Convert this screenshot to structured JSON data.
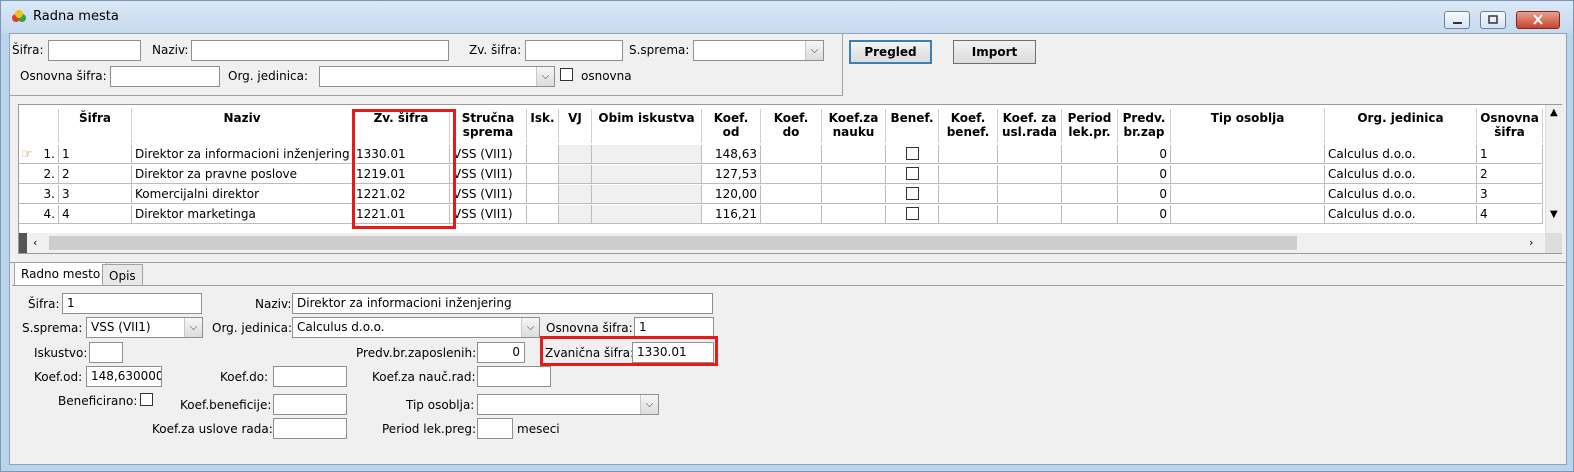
{
  "window": {
    "title": "Radna mesta"
  },
  "filter": {
    "sifra_label": "Šifra:",
    "sifra_value": "",
    "naziv_label": "Naziv:",
    "naziv_value": "",
    "zv_sifra_label": "Zv. šifra:",
    "zv_sifra_value": "",
    "ssprema_label": "S.sprema:",
    "ssprema_value": "",
    "osnovna_sifra_label": "Osnovna šifra:",
    "osnovna_sifra_value": "",
    "org_jedinica_label": "Org. jedinica:",
    "org_jedinica_value": "",
    "osnovna_label": "osnovna"
  },
  "buttons": {
    "pregled": "Pregled",
    "import": "Import"
  },
  "grid": {
    "headers": {
      "sifra": "Šifra",
      "naziv": "Naziv",
      "zv_sifra": "Zv. šifra",
      "strucna1": "Stručna",
      "strucna2": "sprema",
      "isk": "Isk.",
      "vj": "VJ",
      "obim": "Obim iskustva",
      "koef_od1": "Koef.",
      "koef_od2": "od",
      "koef_do1": "Koef.",
      "koef_do2": "do",
      "koef_za1": "Koef.za",
      "koef_za2": "nauku",
      "benef": "Benef.",
      "kbenef1": "Koef.",
      "kbenef2": "benef.",
      "kusl1": "Koef. za",
      "kusl2": "usl.rada",
      "per1": "Period",
      "per2": "lek.pr.",
      "predv1": "Predv.",
      "predv2": "br.zap",
      "tip": "Tip osoblja",
      "org": "Org. jedinica",
      "osn1": "Osnovna",
      "osn2": "šifra"
    },
    "rows": [
      {
        "n": "1.",
        "sifra": "1",
        "naziv": "Direktor za informacioni inženjering",
        "zv": "1330.01",
        "sprema": "VSS (VII1)",
        "koef_od": "148,63",
        "predv": "0",
        "org": "Calculus d.o.o.",
        "osn": "1"
      },
      {
        "n": "2.",
        "sifra": "2",
        "naziv": "Direktor za pravne poslove",
        "zv": "1219.01",
        "sprema": "VSS (VII1)",
        "koef_od": "127,53",
        "predv": "0",
        "org": "Calculus d.o.o.",
        "osn": "2"
      },
      {
        "n": "3.",
        "sifra": "3",
        "naziv": "Komercijalni direktor",
        "zv": "1221.02",
        "sprema": "VSS (VII1)",
        "koef_od": "120,00",
        "predv": "0",
        "org": "Calculus d.o.o.",
        "osn": "3"
      },
      {
        "n": "4.",
        "sifra": "4",
        "naziv": "Direktor marketinga",
        "zv": "1221.01",
        "sprema": "VSS (VII1)",
        "koef_od": "116,21",
        "predv": "0",
        "org": "Calculus d.o.o.",
        "osn": "4"
      }
    ]
  },
  "tabs": {
    "radno_mesto": "Radno mesto",
    "opis": "Opis"
  },
  "detail": {
    "sifra_label": "Šifra:",
    "sifra_value": "1",
    "naziv_label": "Naziv:",
    "naziv_value": "Direktor za informacioni inženjering",
    "ssprema_label": "S.sprema:",
    "ssprema_value": "VSS (VII1)",
    "org_label": "Org. jedinica:",
    "org_value": "Calculus d.o.o.",
    "osnovna_sifra_label": "Osnovna šifra:",
    "osnovna_sifra_value": "1",
    "iskustvo_label": "Iskustvo:",
    "iskustvo_value": "",
    "predv_label": "Predv.br.zaposlenih:",
    "predv_value": "0",
    "zvanicna_label": "Zvanična šifra:",
    "zvanicna_value": "1330.01",
    "koef_od_label": "Koef.od:",
    "koef_od_value": "148,6300000",
    "koef_do_label": "Koef.do:",
    "koef_do_value": "",
    "koef_nauc_label": "Koef.za nauč.rad:",
    "koef_nauc_value": "",
    "beneficirano_label": "Beneficirano:",
    "koef_benef_label": "Koef.beneficije:",
    "koef_benef_value": "",
    "tip_label": "Tip osoblja:",
    "tip_value": "",
    "koef_usl_label": "Koef.za uslove rada:",
    "koef_usl_value": "",
    "period_label": "Period lek.preg:",
    "period_value": "",
    "meseci": "meseci"
  },
  "colors": {
    "highlight": "#e41b1b",
    "titlebar": "#c6d9ee"
  }
}
